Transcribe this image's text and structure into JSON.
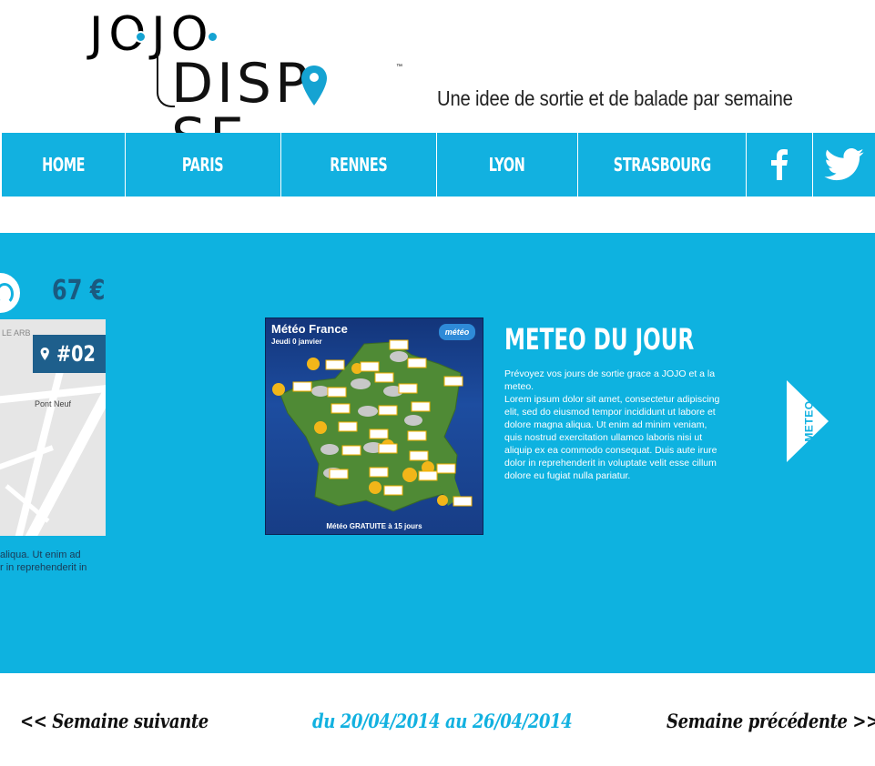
{
  "logo": {
    "line1": "JOJO",
    "line2": "DISP",
    "line2_end": "SE",
    "tm": "™"
  },
  "tagline": "Une idee de sortie et de balade par semaine",
  "nav": {
    "items": [
      {
        "label": "HOME"
      },
      {
        "label": "PARIS"
      },
      {
        "label": "RENNES"
      },
      {
        "label": "LYON"
      },
      {
        "label": "STRASBOURG"
      }
    ],
    "social": [
      "facebook-icon",
      "twitter-icon"
    ]
  },
  "slider": {
    "price": "67 €",
    "map_tag": "#02",
    "map_labels": [
      "Pont Neuf",
      "LE ARB"
    ],
    "left_text": [
      "aliqua. Ut enim ad",
      "r in reprehenderit in"
    ],
    "weather": {
      "title": "Météo France",
      "subtitle": "Jeudi 0 janvier",
      "brand": "météo",
      "footer": "Météo GRATUITE à 15 jours"
    },
    "meteo_title": "METEO DU JOUR",
    "meteo_paragraphs": [
      "Prévoyez vos jours de sortie grace a JOJO et a la meteo.",
      "Lorem ipsum dolor sit amet, consectetur adipiscing elit, sed do eiusmod tempor incidi­dunt ut labore et dolore magna aliqua. Ut enim ad minim veniam, quis nostrud exercitation ullamco laboris nisi ut aliquip ex ea commodo consequat. Duis aute irure dolor in reprehen­derit in voluptate velit esse cillum dolore eu fugiat nulla pariatur."
    ],
    "next_tab": "METEO"
  },
  "week_nav": {
    "prev": "<< Semaine suivante",
    "range": "du 20/04/2014 au 26/04/2014",
    "next": "Semaine précédente >>"
  },
  "colors": {
    "brand_blue": "#12b1e0",
    "dark_blue": "#1e5f8c"
  }
}
